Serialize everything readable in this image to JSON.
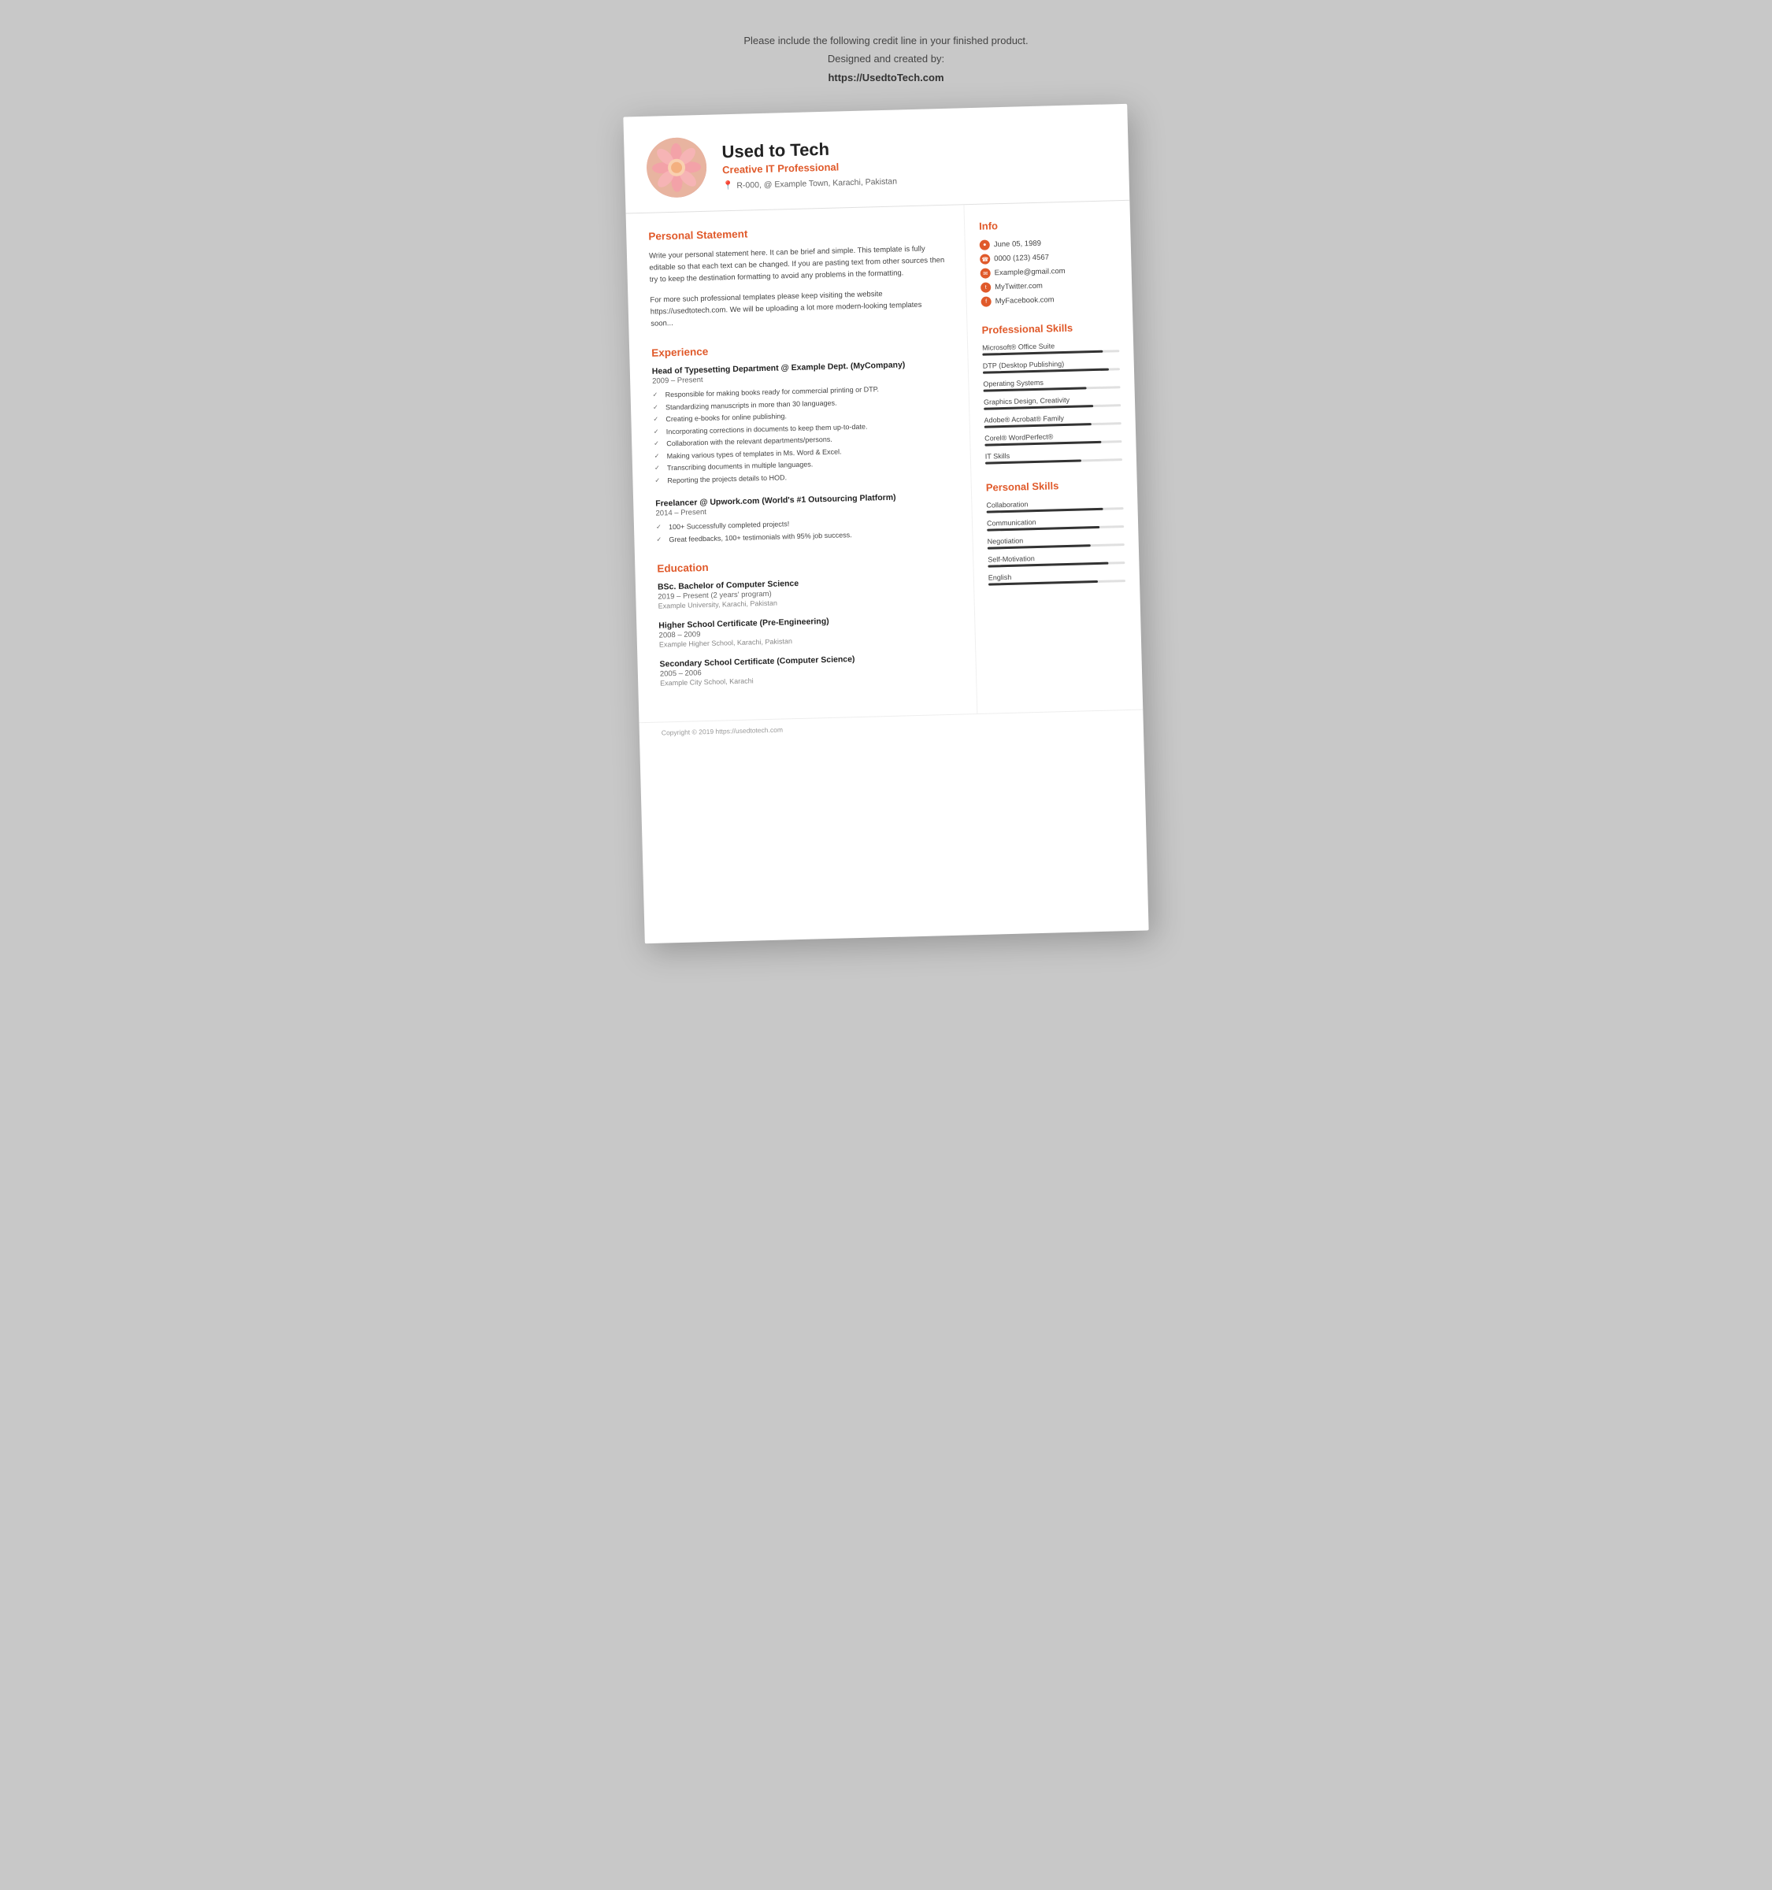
{
  "credit": {
    "line1": "Please include the following credit line in your finished product.",
    "line2": "Designed and created by:",
    "link": "https://UsedtoTech.com"
  },
  "header": {
    "name": "Used to Tech",
    "title": "Creative IT Professional",
    "address": "R-000, @ Example Town, Karachi, Pakistan"
  },
  "personal_statement": {
    "section_title": "Personal Statement",
    "text1": "Write your personal statement here. It can be brief and simple. This template is fully editable so that each text can be changed. If you are pasting text from other sources then try to keep the destination formatting to avoid any problems in the formatting.",
    "text2": "For more such professional templates please keep visiting the website https://usedtotech.com. We will be uploading a lot more modern-looking templates soon..."
  },
  "experience": {
    "section_title": "Experience",
    "items": [
      {
        "title": "Head of Typesetting Department @ Example Dept. (MyCompany)",
        "date": "2009 – Present",
        "bullets": [
          "Responsible for making books ready for commercial printing or DTP.",
          "Standardizing manuscripts in more than 30 languages.",
          "Creating e-books for online publishing.",
          "Incorporating corrections in documents to keep them up-to-date.",
          "Collaboration with the relevant departments/persons.",
          "Making various types of templates in Ms. Word & Excel.",
          "Transcribing documents in multiple languages.",
          "Reporting the projects details to HOD."
        ]
      },
      {
        "title": "Freelancer @ Upwork.com (World's #1 Outsourcing Platform)",
        "date": "2014 – Present",
        "bullets": [
          "100+ Successfully completed projects!",
          "Great feedbacks, 100+ testimonials with 95% job success."
        ]
      }
    ]
  },
  "education": {
    "section_title": "Education",
    "items": [
      {
        "degree": "BSc. Bachelor of Computer Science",
        "date": "2019 – Present (2 years' program)",
        "place": "Example University, Karachi, Pakistan"
      },
      {
        "degree": "Higher School Certificate (Pre-Engineering)",
        "date": "2008 – 2009",
        "place": "Example Higher School, Karachi, Pakistan"
      },
      {
        "degree": "Secondary School Certificate (Computer Science)",
        "date": "2005 – 2006",
        "place": "Example City School, Karachi"
      }
    ]
  },
  "info": {
    "section_title": "Info",
    "items": [
      {
        "icon": "cake",
        "text": "June 05, 1989"
      },
      {
        "icon": "phone",
        "text": "0000 (123) 4567"
      },
      {
        "icon": "email",
        "text": "Example@gmail.com"
      },
      {
        "icon": "twitter",
        "text": "MyTwitter.com"
      },
      {
        "icon": "facebook",
        "text": "MyFacebook.com"
      }
    ]
  },
  "professional_skills": {
    "section_title": "Professional Skills",
    "items": [
      {
        "name": "Microsoft® Office Suite",
        "pct": 88
      },
      {
        "name": "DTP (Desktop Publishing)",
        "pct": 92
      },
      {
        "name": "Operating Systems",
        "pct": 75
      },
      {
        "name": "Graphics Design, Creativity",
        "pct": 80
      },
      {
        "name": "Adobe® Acrobat® Family",
        "pct": 78
      },
      {
        "name": "Corel® WordPerfect®",
        "pct": 85
      },
      {
        "name": "IT Skills",
        "pct": 70
      }
    ]
  },
  "personal_skills": {
    "section_title": "Personal Skills",
    "items": [
      {
        "name": "Collaboration",
        "pct": 85
      },
      {
        "name": "Communication",
        "pct": 82
      },
      {
        "name": "Negotiation",
        "pct": 75
      },
      {
        "name": "Self-Motivation",
        "pct": 88
      },
      {
        "name": "English",
        "pct": 80
      }
    ]
  },
  "footer": {
    "text": "Copyright © 2019 https://usedtotech.com"
  }
}
